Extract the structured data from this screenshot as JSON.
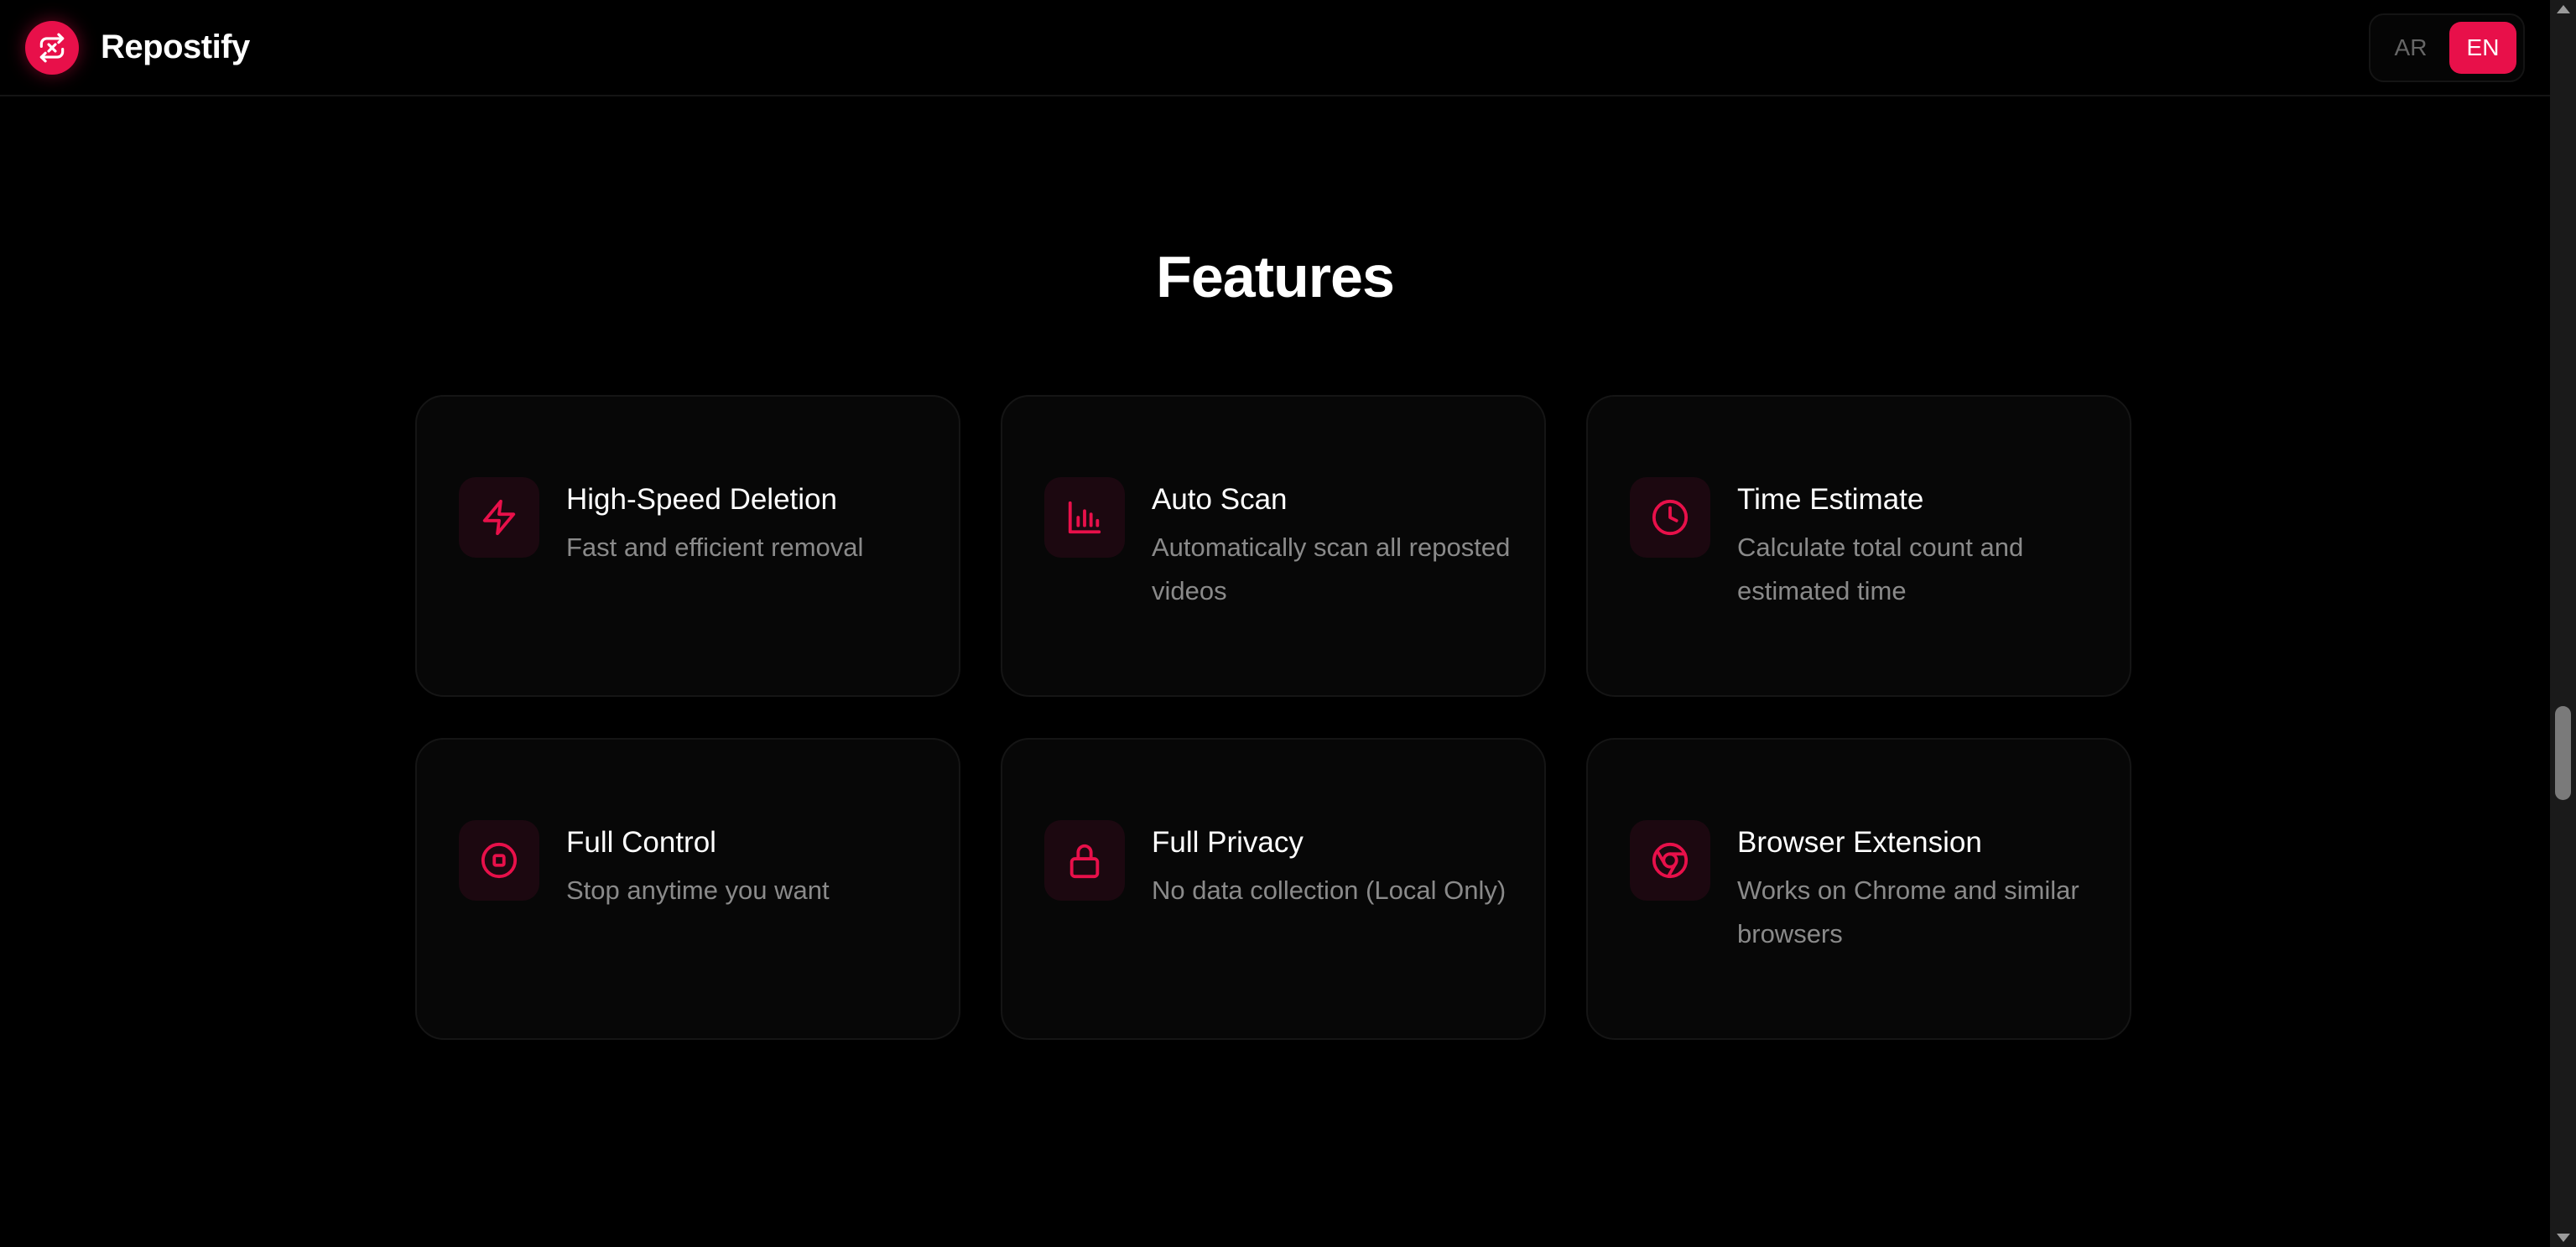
{
  "brand": {
    "name": "Repostify",
    "logo_icon": "repost-icon",
    "accent": "#e8104a"
  },
  "language": {
    "options": [
      "AR",
      "EN"
    ],
    "active": "EN"
  },
  "features": {
    "title": "Features",
    "items": [
      {
        "icon": "lightning-icon",
        "title": "High-Speed Deletion",
        "desc": "Fast and efficient removal"
      },
      {
        "icon": "bar-chart-icon",
        "title": "Auto Scan",
        "desc": "Automatically scan all reposted videos"
      },
      {
        "icon": "clock-icon",
        "title": "Time Estimate",
        "desc": "Calculate total count and estimated time"
      },
      {
        "icon": "stop-circle-icon",
        "title": "Full Control",
        "desc": "Stop anytime you want"
      },
      {
        "icon": "lock-icon",
        "title": "Full Privacy",
        "desc": "No data collection (Local Only)"
      },
      {
        "icon": "chrome-icon",
        "title": "Browser Extension",
        "desc": "Works on Chrome and similar browsers"
      }
    ]
  }
}
